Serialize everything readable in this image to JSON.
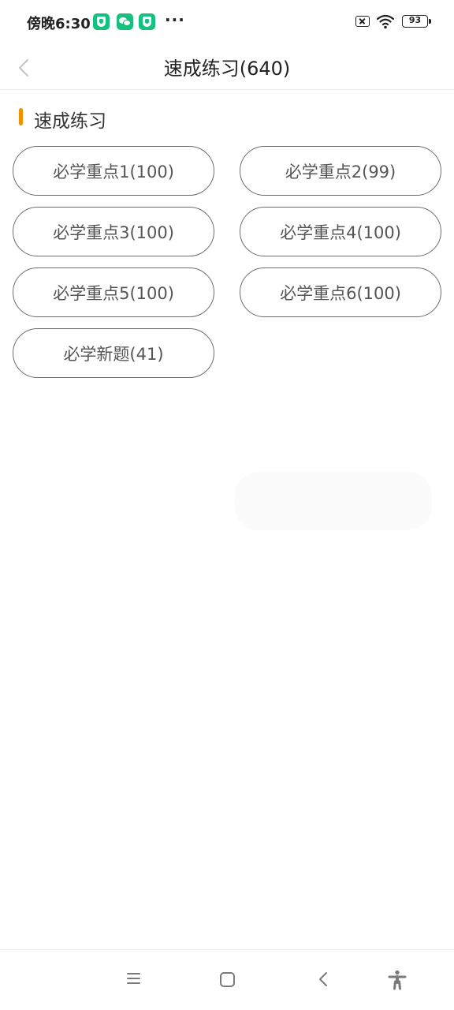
{
  "status_bar": {
    "time": "傍晚6:30",
    "more": "···",
    "battery": "93",
    "icons": [
      "shield-app-icon",
      "wechat-icon",
      "shield-app-icon",
      "sim-x-icon",
      "wifi-icon",
      "battery-icon"
    ]
  },
  "header": {
    "back_icon": "chevron-left-icon",
    "title": "速成练习(640)"
  },
  "section": {
    "title": "速成练习",
    "accent_color": "#f29100",
    "buttons": [
      {
        "label": "必学重点1(100)"
      },
      {
        "label": "必学重点2(99)"
      },
      {
        "label": "必学重点3(100)"
      },
      {
        "label": "必学重点4(100)"
      },
      {
        "label": "必学重点5(100)"
      },
      {
        "label": "必学重点6(100)"
      },
      {
        "label": "必学新题(41)"
      }
    ]
  },
  "system_nav": {
    "icons": [
      "menu-icon",
      "home-icon",
      "back-icon",
      "accessibility-icon"
    ]
  }
}
